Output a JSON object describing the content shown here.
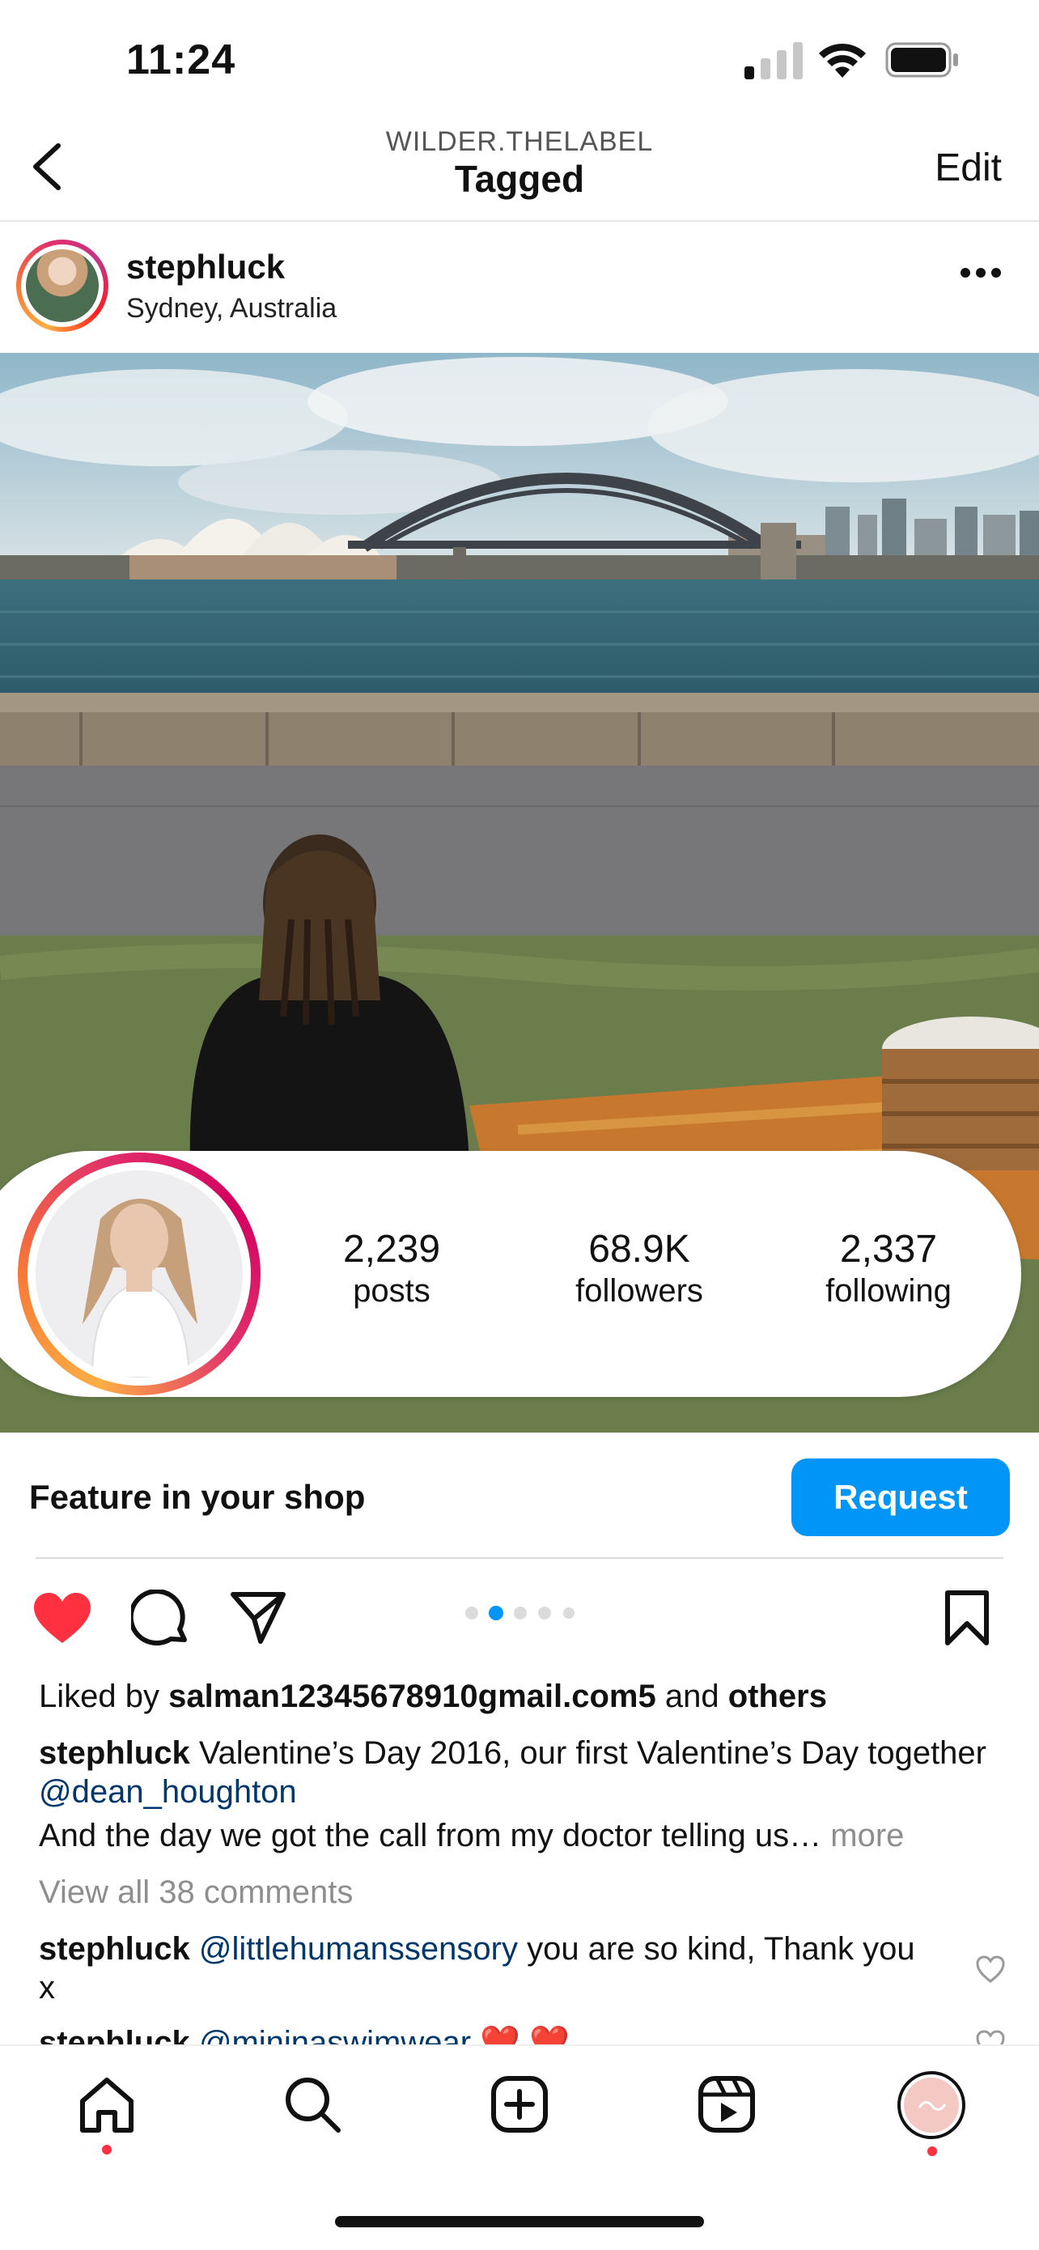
{
  "status_bar": {
    "time": "11:24"
  },
  "header": {
    "account": "WILDER.THELABEL",
    "title": "Tagged",
    "edit_label": "Edit"
  },
  "post": {
    "username": "stephluck",
    "location": "Sydney, Australia"
  },
  "profile_card": {
    "stats": [
      {
        "value": "2,239",
        "label": "posts"
      },
      {
        "value": "68.9K",
        "label": "followers"
      },
      {
        "value": "2,337",
        "label": "following"
      }
    ]
  },
  "feature": {
    "text": "Feature in your shop",
    "button_label": "Request"
  },
  "carousel": {
    "count": 5,
    "active_index": 1
  },
  "likes": {
    "prefix": "Liked by ",
    "user": "salman12345678910gmail.com5",
    "middle": " and ",
    "others": "others"
  },
  "caption": {
    "username": "stephluck",
    "text": " Valentine’s Day 2016, our first Valentine’s Day together ",
    "mention": "@dean_houghton",
    "line2": "And the day we got the call from my doctor telling us…",
    "more": " more"
  },
  "view_comments": "View all 38 comments",
  "comments": [
    {
      "username": "stephluck",
      "mention": "@littlehumanssensory",
      "text": " you are so kind, Thank you x"
    },
    {
      "username": "stephluck",
      "mention": "@mininaswimwear",
      "text": " ❤️ ❤️"
    }
  ],
  "colors": {
    "accent": "#0095f6",
    "like": "#ff3040",
    "mention": "#00376b",
    "muted": "#8e8e8e"
  },
  "tabs": [
    {
      "icon": "home-icon"
    },
    {
      "icon": "search-icon"
    },
    {
      "icon": "new-post-icon"
    },
    {
      "icon": "reels-icon"
    },
    {
      "icon": "profile-avatar-icon"
    }
  ]
}
